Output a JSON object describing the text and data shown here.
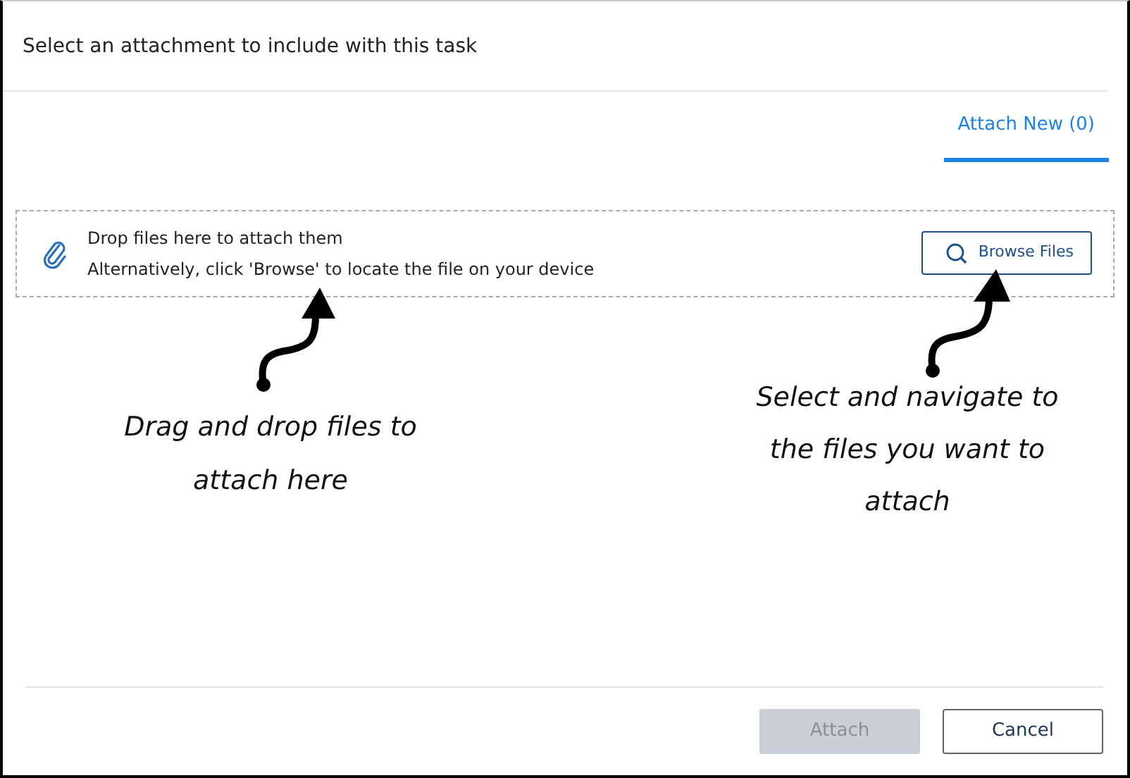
{
  "dialog": {
    "title": "Select an attachment to include with this task"
  },
  "tabs": [
    {
      "label": "Attach New (0)",
      "selected": true
    }
  ],
  "dropzone": {
    "title": "Drop files here to attach them",
    "subtitle": "Alternatively, click 'Browse' to locate the file on your device",
    "browse_button": "Browse Files"
  },
  "annotations": [
    {
      "kind": "left",
      "text": "Drag and drop files to attach here"
    },
    {
      "kind": "right",
      "text": "Select and navigate to the files you want to attach"
    }
  ],
  "buttons": [
    {
      "label": "Attach",
      "disabled": true,
      "kind": "primary"
    },
    {
      "label": "Cancel",
      "disabled": false,
      "kind": "secondary"
    }
  ]
}
